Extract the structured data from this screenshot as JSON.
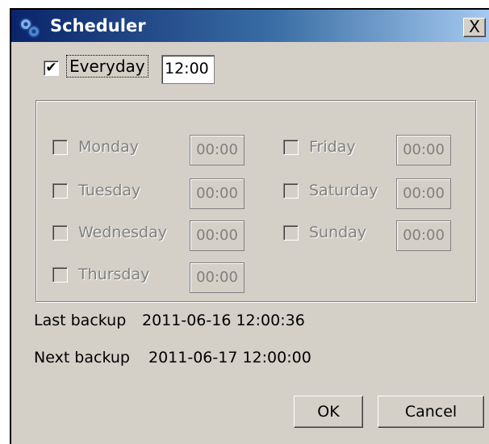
{
  "window": {
    "title": "Scheduler",
    "close_label": "X"
  },
  "everyday": {
    "label": "Everyday",
    "checked": true,
    "time": "12:00"
  },
  "days": [
    {
      "name": "Monday",
      "time": "00:00",
      "checked": false,
      "enabled": false
    },
    {
      "name": "Tuesday",
      "time": "00:00",
      "checked": false,
      "enabled": false
    },
    {
      "name": "Wednesday",
      "time": "00:00",
      "checked": false,
      "enabled": false
    },
    {
      "name": "Thursday",
      "time": "00:00",
      "checked": false,
      "enabled": false
    },
    {
      "name": "Friday",
      "time": "00:00",
      "checked": false,
      "enabled": false
    },
    {
      "name": "Saturday",
      "time": "00:00",
      "checked": false,
      "enabled": false
    },
    {
      "name": "Sunday",
      "time": "00:00",
      "checked": false,
      "enabled": false
    }
  ],
  "status": {
    "last_label": "Last backup",
    "last_value": "2011-06-16 12:00:36",
    "next_label": "Next backup",
    "next_value": "2011-06-17 12:00:00"
  },
  "buttons": {
    "ok": "OK",
    "cancel": "Cancel"
  },
  "colors": {
    "title_gradient_start": "#0a246a",
    "title_gradient_end": "#a6caf0",
    "window_bg": "#d4d0c8",
    "disabled_text": "#808080"
  },
  "icons": {
    "title": "gears-icon",
    "checkmark": "checkmark-icon"
  }
}
